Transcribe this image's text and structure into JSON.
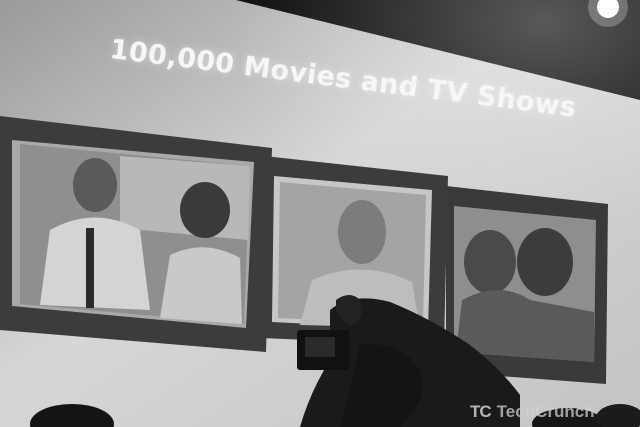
{
  "slide": {
    "headline": "100,000 Movies and TV Shows"
  },
  "watermark": {
    "mark": "TC",
    "text": "TechCrunch"
  },
  "colors": {
    "stage_dark": "#0c0c0c",
    "screen_gray": "#cfcfcf",
    "tablet_frame": "#3a3a3a"
  },
  "scene_description_icons": [
    "tablet-device",
    "audience-hand-with-camera"
  ]
}
